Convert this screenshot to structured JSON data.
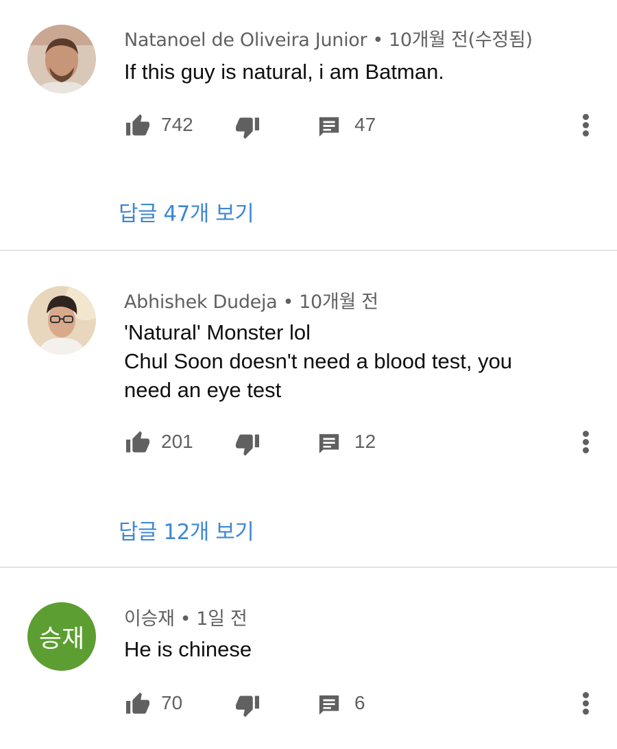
{
  "comments": [
    {
      "author": "Natanoel de Oliveira Junior",
      "time": "10개월 전(수정됨)",
      "lines": [
        "If this guy is natural, i am Batman."
      ],
      "likes": "742",
      "replies": "47",
      "view_replies": "답글 47개 보기"
    },
    {
      "author": "Abhishek Dudeja",
      "time": "10개월 전",
      "lines": [
        "'Natural' Monster lol",
        "Chul Soon doesn't need a blood test, you",
        "need an eye test"
      ],
      "likes": "201",
      "replies": "12",
      "view_replies": "답글 12개 보기"
    },
    {
      "author": "이승재",
      "time": "1일 전",
      "avatar_letters": "승재",
      "avatar_color": "#5c9e31",
      "lines": [
        "He is chinese"
      ],
      "likes": "70",
      "replies": "6"
    }
  ],
  "separator": "•",
  "colors": {
    "link": "#3e87d4",
    "meta": "#606060",
    "divider": "#e3e3e3"
  },
  "icons": [
    "thumb-up-icon",
    "thumb-down-icon",
    "reply-comment-icon",
    "more-vert-icon"
  ]
}
